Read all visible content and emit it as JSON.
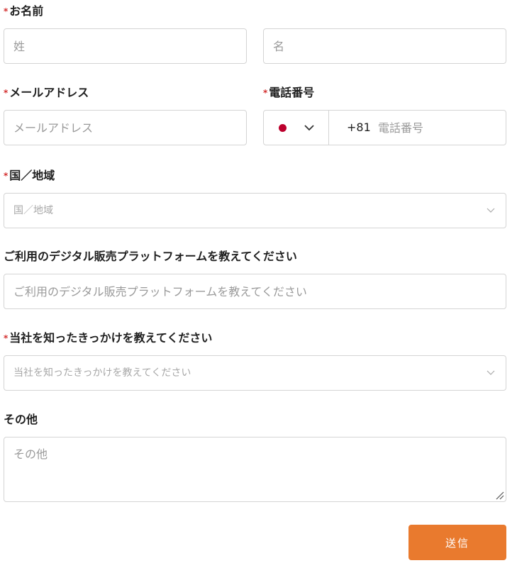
{
  "fields": {
    "name": {
      "label": "お名前",
      "required_mark": "*",
      "last_placeholder": "姓",
      "first_placeholder": "名"
    },
    "email": {
      "label": "メールアドレス",
      "required_mark": "*",
      "placeholder": "メールアドレス"
    },
    "phone": {
      "label": "電話番号",
      "required_mark": "*",
      "country_flag": "japan-flag",
      "flag_color": "#bc002d",
      "dial_code": "+81",
      "placeholder": "電話番号"
    },
    "country": {
      "label": "国／地域",
      "required_mark": "*",
      "placeholder": "国／地域"
    },
    "platform": {
      "label": "ご利用のデジタル販売プラットフォームを教えてください",
      "placeholder": "ご利用のデジタル販売プラットフォームを教えてください"
    },
    "source": {
      "label": "当社を知ったきっかけを教えてください",
      "required_mark": "*",
      "placeholder": "当社を知ったきっかけを教えてください"
    },
    "other": {
      "label": "その他",
      "placeholder": "その他"
    }
  },
  "submit": {
    "label": "送信",
    "color": "#e97a2e"
  },
  "colors": {
    "required": "#d32f2f",
    "border": "#d4d4d4",
    "placeholder": "#9a9a9a"
  }
}
